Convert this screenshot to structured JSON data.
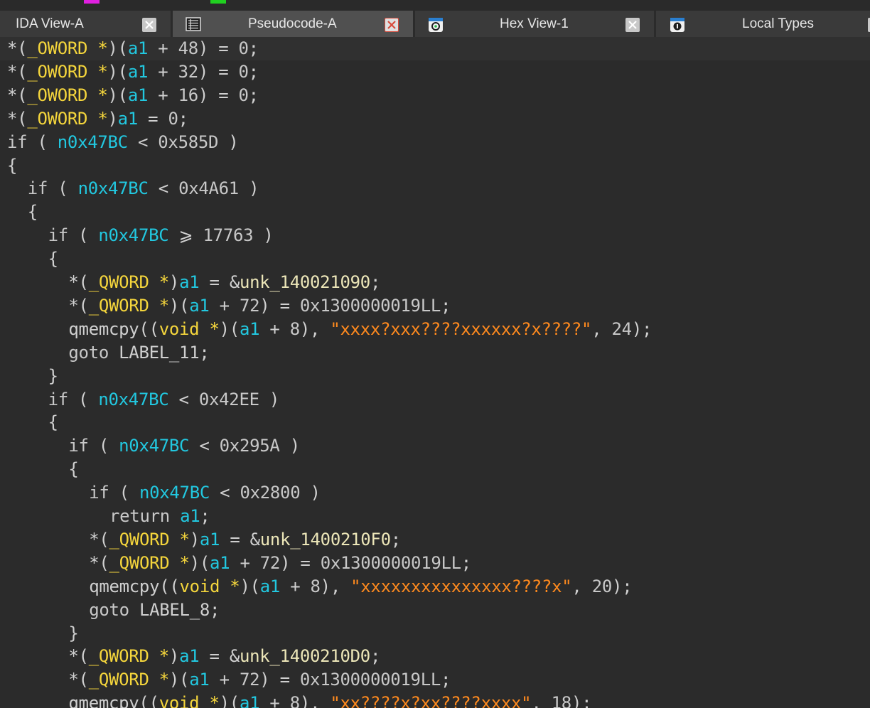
{
  "colors": {
    "background": "#2b2b2b",
    "tab_bar": "#3a3a3a",
    "active_tab": "#505050",
    "type_color": "#f5d63c",
    "variable_color": "#22c8e0",
    "string_color": "#ff8a1e",
    "text_color": "#d0d0d0",
    "close_red": "#d84a3a",
    "marker_magenta": "#e020e0",
    "marker_green": "#20d020"
  },
  "tabs": [
    {
      "label": "IDA View-A",
      "icon": "",
      "active": false
    },
    {
      "label": "Pseudocode-A",
      "icon": "pseudocode-icon",
      "active": true
    },
    {
      "label": "Hex View-1",
      "icon": "hex-view-icon",
      "active": false
    },
    {
      "label": "Local Types",
      "icon": "local-types-icon",
      "active": false
    }
  ],
  "code_lines": [
    {
      "indent": 0,
      "tokens": [
        [
          "pl",
          "*("
        ],
        [
          "ty",
          "_OWORD *"
        ],
        [
          "pl",
          ")("
        ],
        [
          "vr",
          "a1"
        ],
        [
          "pl",
          " + "
        ],
        [
          "nu",
          "48"
        ],
        [
          "pl",
          ") = "
        ],
        [
          "nu",
          "0"
        ],
        [
          "pl",
          ";"
        ]
      ]
    },
    {
      "indent": 0,
      "tokens": [
        [
          "pl",
          "*("
        ],
        [
          "ty",
          "_OWORD *"
        ],
        [
          "pl",
          ")("
        ],
        [
          "vr",
          "a1"
        ],
        [
          "pl",
          " + "
        ],
        [
          "nu",
          "32"
        ],
        [
          "pl",
          ") = "
        ],
        [
          "nu",
          "0"
        ],
        [
          "pl",
          ";"
        ]
      ]
    },
    {
      "indent": 0,
      "tokens": [
        [
          "pl",
          "*("
        ],
        [
          "ty",
          "_OWORD *"
        ],
        [
          "pl",
          ")("
        ],
        [
          "vr",
          "a1"
        ],
        [
          "pl",
          " + "
        ],
        [
          "nu",
          "16"
        ],
        [
          "pl",
          ") = "
        ],
        [
          "nu",
          "0"
        ],
        [
          "pl",
          ";"
        ]
      ]
    },
    {
      "indent": 0,
      "tokens": [
        [
          "pl",
          "*("
        ],
        [
          "ty",
          "_OWORD *"
        ],
        [
          "pl",
          ")"
        ],
        [
          "vr",
          "a1"
        ],
        [
          "pl",
          " = "
        ],
        [
          "nu",
          "0"
        ],
        [
          "pl",
          ";"
        ]
      ]
    },
    {
      "indent": 0,
      "tokens": [
        [
          "kw",
          "if"
        ],
        [
          "pl",
          " ( "
        ],
        [
          "vr",
          "n0x47BC"
        ],
        [
          "pl",
          " < "
        ],
        [
          "nu",
          "0x585D"
        ],
        [
          "pl",
          " )"
        ]
      ]
    },
    {
      "indent": 0,
      "tokens": [
        [
          "pl",
          "{"
        ]
      ]
    },
    {
      "indent": 1,
      "tokens": [
        [
          "kw",
          "if"
        ],
        [
          "pl",
          " ( "
        ],
        [
          "vr",
          "n0x47BC"
        ],
        [
          "pl",
          " < "
        ],
        [
          "nu",
          "0x4A61"
        ],
        [
          "pl",
          " )"
        ]
      ]
    },
    {
      "indent": 1,
      "tokens": [
        [
          "pl",
          "{"
        ]
      ]
    },
    {
      "indent": 2,
      "tokens": [
        [
          "kw",
          "if"
        ],
        [
          "pl",
          " ( "
        ],
        [
          "vr",
          "n0x47BC"
        ],
        [
          "pl",
          " ⩾ "
        ],
        [
          "nu",
          "17763"
        ],
        [
          "pl",
          " )"
        ]
      ]
    },
    {
      "indent": 2,
      "tokens": [
        [
          "pl",
          "{"
        ]
      ]
    },
    {
      "indent": 3,
      "tokens": [
        [
          "pl",
          "*("
        ],
        [
          "ty",
          "_QWORD *"
        ],
        [
          "pl",
          ")"
        ],
        [
          "vr",
          "a1"
        ],
        [
          "pl",
          " = &"
        ],
        [
          "gl",
          "unk_140021090"
        ],
        [
          "pl",
          ";"
        ]
      ]
    },
    {
      "indent": 3,
      "tokens": [
        [
          "pl",
          "*("
        ],
        [
          "ty",
          "_QWORD *"
        ],
        [
          "pl",
          ")("
        ],
        [
          "vr",
          "a1"
        ],
        [
          "pl",
          " + "
        ],
        [
          "nu",
          "72"
        ],
        [
          "pl",
          ") = "
        ],
        [
          "nu",
          "0x1300000019LL"
        ],
        [
          "pl",
          ";"
        ]
      ]
    },
    {
      "indent": 3,
      "tokens": [
        [
          "pl",
          "qmemcpy(("
        ],
        [
          "ty",
          "void *"
        ],
        [
          "pl",
          ")("
        ],
        [
          "vr",
          "a1"
        ],
        [
          "pl",
          " + "
        ],
        [
          "nu",
          "8"
        ],
        [
          "pl",
          "), "
        ],
        [
          "st",
          "\"xxxx?xxx????xxxxxx?x????\""
        ],
        [
          "pl",
          ", "
        ],
        [
          "nu",
          "24"
        ],
        [
          "pl",
          ");"
        ]
      ]
    },
    {
      "indent": 3,
      "tokens": [
        [
          "kw",
          "goto"
        ],
        [
          "pl",
          " LABEL_11;"
        ]
      ]
    },
    {
      "indent": 2,
      "tokens": [
        [
          "pl",
          "}"
        ]
      ]
    },
    {
      "indent": 2,
      "tokens": [
        [
          "kw",
          "if"
        ],
        [
          "pl",
          " ( "
        ],
        [
          "vr",
          "n0x47BC"
        ],
        [
          "pl",
          " < "
        ],
        [
          "nu",
          "0x42EE"
        ],
        [
          "pl",
          " )"
        ]
      ]
    },
    {
      "indent": 2,
      "tokens": [
        [
          "pl",
          "{"
        ]
      ]
    },
    {
      "indent": 3,
      "tokens": [
        [
          "kw",
          "if"
        ],
        [
          "pl",
          " ( "
        ],
        [
          "vr",
          "n0x47BC"
        ],
        [
          "pl",
          " < "
        ],
        [
          "nu",
          "0x295A"
        ],
        [
          "pl",
          " )"
        ]
      ]
    },
    {
      "indent": 3,
      "tokens": [
        [
          "pl",
          "{"
        ]
      ]
    },
    {
      "indent": 4,
      "tokens": [
        [
          "kw",
          "if"
        ],
        [
          "pl",
          " ( "
        ],
        [
          "vr",
          "n0x47BC"
        ],
        [
          "pl",
          " < "
        ],
        [
          "nu",
          "0x2800"
        ],
        [
          "pl",
          " )"
        ]
      ]
    },
    {
      "indent": 5,
      "tokens": [
        [
          "kw",
          "return"
        ],
        [
          "pl",
          " "
        ],
        [
          "vr",
          "a1"
        ],
        [
          "pl",
          ";"
        ]
      ]
    },
    {
      "indent": 4,
      "tokens": [
        [
          "pl",
          "*("
        ],
        [
          "ty",
          "_QWORD *"
        ],
        [
          "pl",
          ")"
        ],
        [
          "vr",
          "a1"
        ],
        [
          "pl",
          " = &"
        ],
        [
          "gl",
          "unk_1400210F0"
        ],
        [
          "pl",
          ";"
        ]
      ]
    },
    {
      "indent": 4,
      "tokens": [
        [
          "pl",
          "*("
        ],
        [
          "ty",
          "_QWORD *"
        ],
        [
          "pl",
          ")("
        ],
        [
          "vr",
          "a1"
        ],
        [
          "pl",
          " + "
        ],
        [
          "nu",
          "72"
        ],
        [
          "pl",
          ") = "
        ],
        [
          "nu",
          "0x1300000019LL"
        ],
        [
          "pl",
          ";"
        ]
      ]
    },
    {
      "indent": 4,
      "tokens": [
        [
          "pl",
          "qmemcpy(("
        ],
        [
          "ty",
          "void *"
        ],
        [
          "pl",
          ")("
        ],
        [
          "vr",
          "a1"
        ],
        [
          "pl",
          " + "
        ],
        [
          "nu",
          "8"
        ],
        [
          "pl",
          "), "
        ],
        [
          "st",
          "\"xxxxxxxxxxxxxxx????x\""
        ],
        [
          "pl",
          ", "
        ],
        [
          "nu",
          "20"
        ],
        [
          "pl",
          ");"
        ]
      ]
    },
    {
      "indent": 4,
      "tokens": [
        [
          "kw",
          "goto"
        ],
        [
          "pl",
          " LABEL_8;"
        ]
      ]
    },
    {
      "indent": 3,
      "tokens": [
        [
          "pl",
          "}"
        ]
      ]
    },
    {
      "indent": 3,
      "tokens": [
        [
          "pl",
          "*("
        ],
        [
          "ty",
          "_QWORD *"
        ],
        [
          "pl",
          ")"
        ],
        [
          "vr",
          "a1"
        ],
        [
          "pl",
          " = &"
        ],
        [
          "gl",
          "unk_1400210D0"
        ],
        [
          "pl",
          ";"
        ]
      ]
    },
    {
      "indent": 3,
      "tokens": [
        [
          "pl",
          "*("
        ],
        [
          "ty",
          "_QWORD *"
        ],
        [
          "pl",
          ")("
        ],
        [
          "vr",
          "a1"
        ],
        [
          "pl",
          " + "
        ],
        [
          "nu",
          "72"
        ],
        [
          "pl",
          ") = "
        ],
        [
          "nu",
          "0x1300000019LL"
        ],
        [
          "pl",
          ";"
        ]
      ]
    },
    {
      "indent": 3,
      "tokens": [
        [
          "pl",
          "qmemcpy(("
        ],
        [
          "ty",
          "void *"
        ],
        [
          "pl",
          ")("
        ],
        [
          "vr",
          "a1"
        ],
        [
          "pl",
          " + "
        ],
        [
          "nu",
          "8"
        ],
        [
          "pl",
          "), "
        ],
        [
          "st",
          "\"xx????x?xx????xxxx\""
        ],
        [
          "pl",
          ", "
        ],
        [
          "nu",
          "18"
        ],
        [
          "pl",
          ");"
        ]
      ]
    }
  ]
}
